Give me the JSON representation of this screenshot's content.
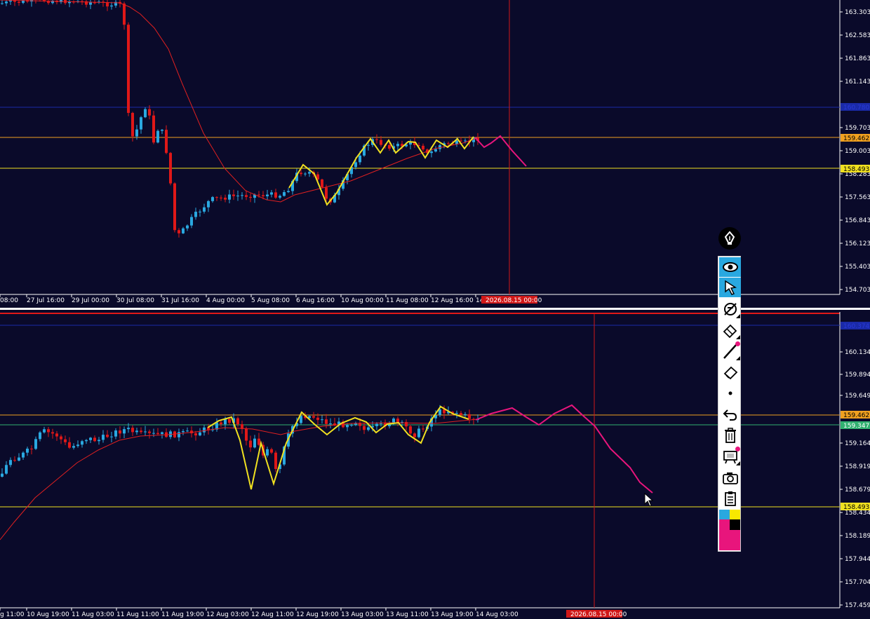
{
  "colors": {
    "background": "#0a0a2a",
    "bull": "#2aa8e0",
    "bear": "#e01818",
    "ma": "#e02020",
    "zigzag": "#f0e020",
    "projection": "#e8157c",
    "orange_line": "#f0a020",
    "yellow_line": "#f0e020",
    "blue_line": "#1a2aa8",
    "green_line": "#30b070",
    "toolbar_active": "#29a8e0"
  },
  "top_panel": {
    "price_labels": [
      "163.303",
      "162.583",
      "161.863",
      "161.143",
      "159.703",
      "159.003",
      "158.283",
      "157.563",
      "156.843",
      "156.123",
      "155.403",
      "154.703"
    ],
    "time_labels": [
      "08:00",
      "27 Jul 16:00",
      "29 Jul 00:00",
      "30 Jul 08:00",
      "31 Jul 16:00",
      "4 Aug 00:00",
      "5 Aug 08:00",
      "6 Aug 16:00",
      "10 Aug 00:00",
      "11 Aug 08:00",
      "12 Aug 16:00",
      "14"
    ],
    "cursor_time": "2026.08.15 00:00",
    "tag_orange": "159.462",
    "tag_yellow": "158.493",
    "tag_blue": "160.780"
  },
  "bottom_panel": {
    "price_labels": [
      "160.134",
      "159.894",
      "159.649",
      "159.164",
      "158.919",
      "158.679",
      "158.434",
      "158.189",
      "157.944",
      "157.704",
      "157.459"
    ],
    "time_labels": [
      "g 11:00",
      "10 Aug 19:00",
      "11 Aug 03:00",
      "11 Aug 11:00",
      "11 Aug 19:00",
      "12 Aug 03:00",
      "12 Aug 11:00",
      "12 Aug 19:00",
      "13 Aug 03:00",
      "13 Aug 11:00",
      "13 Aug 19:00",
      "14 Aug 03:00"
    ],
    "cursor_time": "2026.08.15 00:00",
    "tag_orange": "159.462",
    "tag_green": "159.347",
    "tag_yellow": "158.493",
    "tag_blue": "160.374"
  },
  "toolbar": {
    "logo": "pen-nib-icon",
    "tools": [
      {
        "name": "eye-icon",
        "active": true
      },
      {
        "name": "cursor-arrow-icon",
        "active": true
      },
      {
        "name": "hide-drawings-icon",
        "active": false,
        "corner": true
      },
      {
        "name": "eraser-icon",
        "active": false,
        "corner": true
      },
      {
        "name": "line-icon",
        "active": false,
        "corner": true,
        "dot": true
      },
      {
        "name": "highlighter-icon",
        "active": false
      },
      {
        "name": "dot-icon",
        "active": false
      },
      {
        "name": "undo-icon",
        "active": false
      },
      {
        "name": "trash-icon",
        "active": false
      },
      {
        "name": "screen-icon",
        "active": false,
        "corner": true,
        "dot": true
      },
      {
        "name": "camera-icon",
        "active": false
      },
      {
        "name": "clipboard-icon",
        "active": false
      }
    ],
    "swatches": [
      "#29a8e0",
      "#f8e800",
      "#e8157c",
      "#000000"
    ]
  }
}
